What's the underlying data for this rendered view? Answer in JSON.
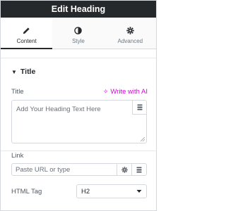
{
  "header": {
    "title": "Edit Heading"
  },
  "tabs": [
    {
      "label": "Content",
      "icon": "pencil-icon",
      "active": true
    },
    {
      "label": "Style",
      "icon": "half-circle-icon",
      "active": false
    },
    {
      "label": "Advanced",
      "icon": "gear-icon",
      "active": false
    }
  ],
  "section": {
    "title": "Title",
    "expanded": true
  },
  "title_field": {
    "label": "Title",
    "ai_link": "Write with AI",
    "placeholder": "Add Your Heading Text Here",
    "value": ""
  },
  "link_field": {
    "label": "Link",
    "placeholder": "Paste URL or type"
  },
  "html_tag": {
    "label": "HTML Tag",
    "value": "H2"
  },
  "colors": {
    "header_bg": "#26292c",
    "ai_accent": "#d004d4",
    "border": "#d5d8dc"
  }
}
